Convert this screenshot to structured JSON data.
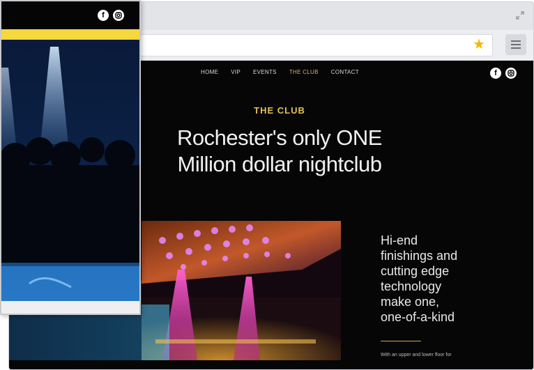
{
  "browser": {
    "nav": [
      "HOME",
      "VIP",
      "EVENTS",
      "THE CLUB",
      "CONTACT"
    ],
    "active_nav": "THE CLUB",
    "social_icons": [
      "facebook-icon",
      "instagram-icon"
    ],
    "star_icon": "bookmark-star-icon"
  },
  "hero": {
    "kicker": "THE CLUB",
    "headline_line1": "Rochester's only ONE",
    "headline_line2": "Million dollar nightclub"
  },
  "feature": {
    "lines": [
      "Hi-end",
      "finishings and",
      "cutting edge",
      "technology",
      "make one,",
      "one-of-a-kind"
    ],
    "small": "With an upper and lower floor for"
  },
  "mobile": {
    "social_icons": [
      "facebook-icon",
      "instagram-icon"
    ]
  },
  "colors": {
    "accent": "#e2c34f",
    "mobile_bar": "#f3d83f",
    "background": "#060606"
  }
}
